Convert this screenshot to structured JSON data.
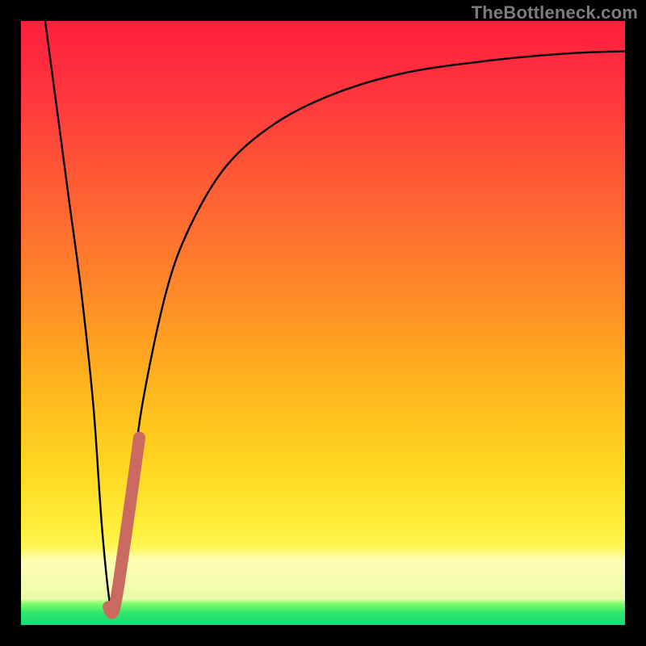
{
  "watermark": "TheBottleneck.com",
  "colors": {
    "frame": "#000000",
    "curve": "#000000",
    "highlight": "#cb6a61",
    "watermark": "#7c7c7c"
  },
  "chart_data": {
    "type": "line",
    "title": "",
    "xlabel": "",
    "ylabel": "",
    "xlim": [
      0,
      100
    ],
    "ylim": [
      0,
      100
    ],
    "grid": false,
    "series": [
      {
        "name": "bottleneck-curve",
        "x": [
          4,
          6,
          8,
          10,
          12,
          13.5,
          15,
          16,
          18,
          20,
          24,
          28,
          34,
          42,
          52,
          64,
          78,
          90,
          100
        ],
        "y": [
          100,
          85,
          70,
          55,
          36,
          15,
          2,
          5,
          20,
          36,
          55,
          66,
          76,
          83,
          88,
          91.5,
          93.5,
          94.6,
          95
        ]
      },
      {
        "name": "highlight-segment",
        "x": [
          14.5,
          15,
          15.5,
          16.2,
          17.8,
          19.6
        ],
        "y": [
          3,
          2,
          3,
          7,
          18,
          31
        ]
      }
    ],
    "annotations": []
  }
}
